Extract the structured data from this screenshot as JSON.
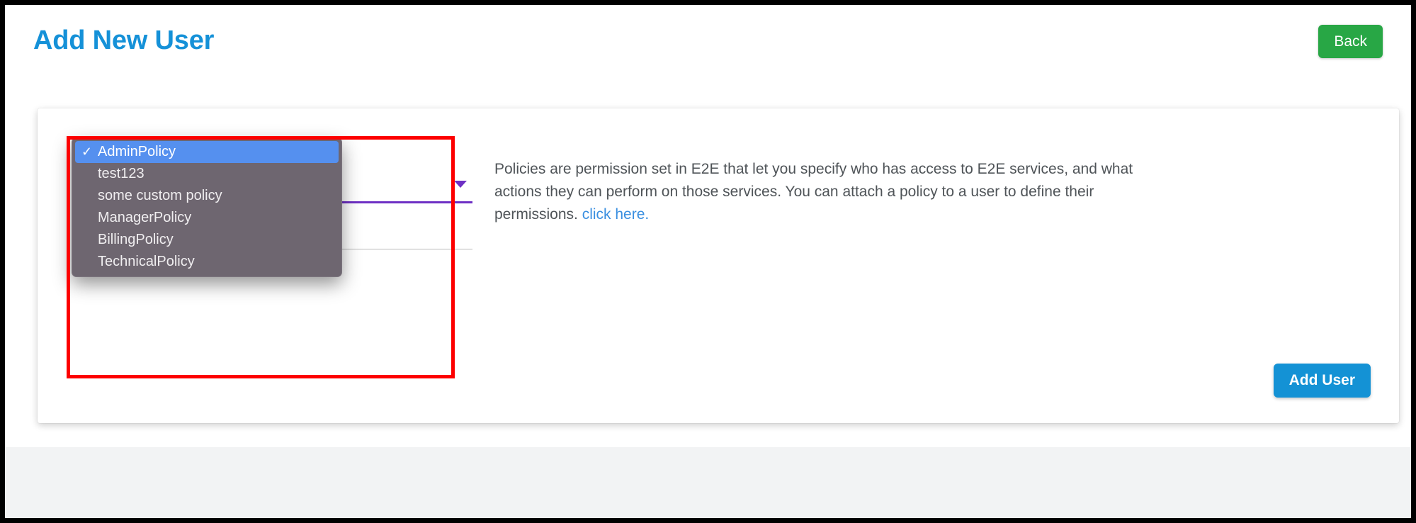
{
  "header": {
    "title": "Add New User",
    "back_label": "Back"
  },
  "colors": {
    "title_blue": "#1591d8",
    "back_green": "#28a745",
    "primary_blue": "#1492d5",
    "link_blue": "#3a8fe0",
    "highlight_red": "#fd0000",
    "menu_background": "#6e6670",
    "menu_selected": "#5590ef",
    "select_underline_purple": "#6e30c4",
    "page_background": "#f2f3f4"
  },
  "policy_select": {
    "selected_value": "AdminPolicy",
    "chevron_icon": "chevron-down-icon",
    "expanded": true,
    "options": [
      {
        "label": "AdminPolicy",
        "selected": true
      },
      {
        "label": "test123",
        "selected": false
      },
      {
        "label": "some custom policy",
        "selected": false
      },
      {
        "label": "ManagerPolicy",
        "selected": false
      },
      {
        "label": "BillingPolicy",
        "selected": false
      },
      {
        "label": "TechnicalPolicy",
        "selected": false
      }
    ],
    "check_glyph": "✓"
  },
  "description": {
    "body": "Policies are permission set in E2E that let you specify who has access to E2E services, and what actions they can perform on those services. You can attach a policy to a user to define their permissions. ",
    "link_text": "click here."
  },
  "actions": {
    "add_user_label": "Add User"
  }
}
